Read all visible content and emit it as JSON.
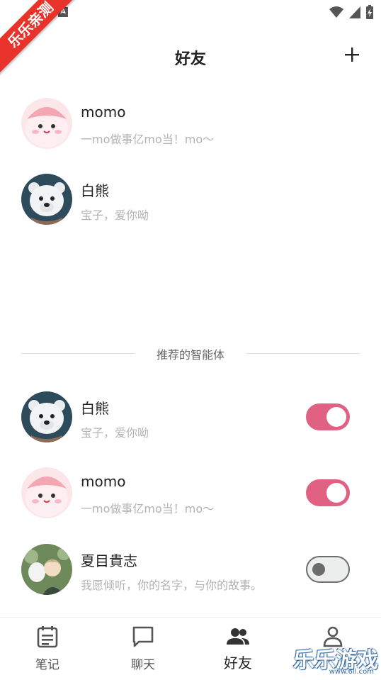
{
  "status_bar": {
    "notification_badge": "A",
    "icons": [
      "wifi-icon",
      "cell-signal-icon",
      "battery-charging-icon"
    ]
  },
  "corner_ribbon": "乐乐亲测",
  "header": {
    "title": "好友",
    "add_icon": "plus-icon"
  },
  "friends": [
    {
      "name": "momo",
      "desc": "一mo做事亿mo当！mo～",
      "avatar": "pink-blob-avatar"
    },
    {
      "name": "白熊",
      "desc": "宝子，爱你呦",
      "avatar": "polar-bear-avatar"
    }
  ],
  "recommended": {
    "label": "推荐的智能体",
    "items": [
      {
        "name": "白熊",
        "desc": "宝子，爱你呦",
        "avatar": "polar-bear-avatar",
        "enabled": true
      },
      {
        "name": "momo",
        "desc": "一mo做事亿mo当！mo～",
        "avatar": "pink-blob-avatar",
        "enabled": true
      },
      {
        "name": "夏目貴志",
        "desc": "我愿倾听，你的名字，与你的故事。",
        "avatar": "anime-boy-avatar",
        "enabled": false
      }
    ]
  },
  "nav": {
    "items": [
      {
        "label": "笔记",
        "icon": "notebook-icon"
      },
      {
        "label": "聊天",
        "icon": "chat-bubble-icon"
      },
      {
        "label": "好友",
        "icon": "people-icon",
        "active": true
      },
      {
        "label": "",
        "icon": "person-icon"
      }
    ]
  },
  "watermark": {
    "text": "乐乐游戏",
    "sub": "www.6ll.com"
  },
  "colors": {
    "accent": "#e06182",
    "toggle_off": "#6c6c6c",
    "muted_text": "#b3b3b3"
  }
}
